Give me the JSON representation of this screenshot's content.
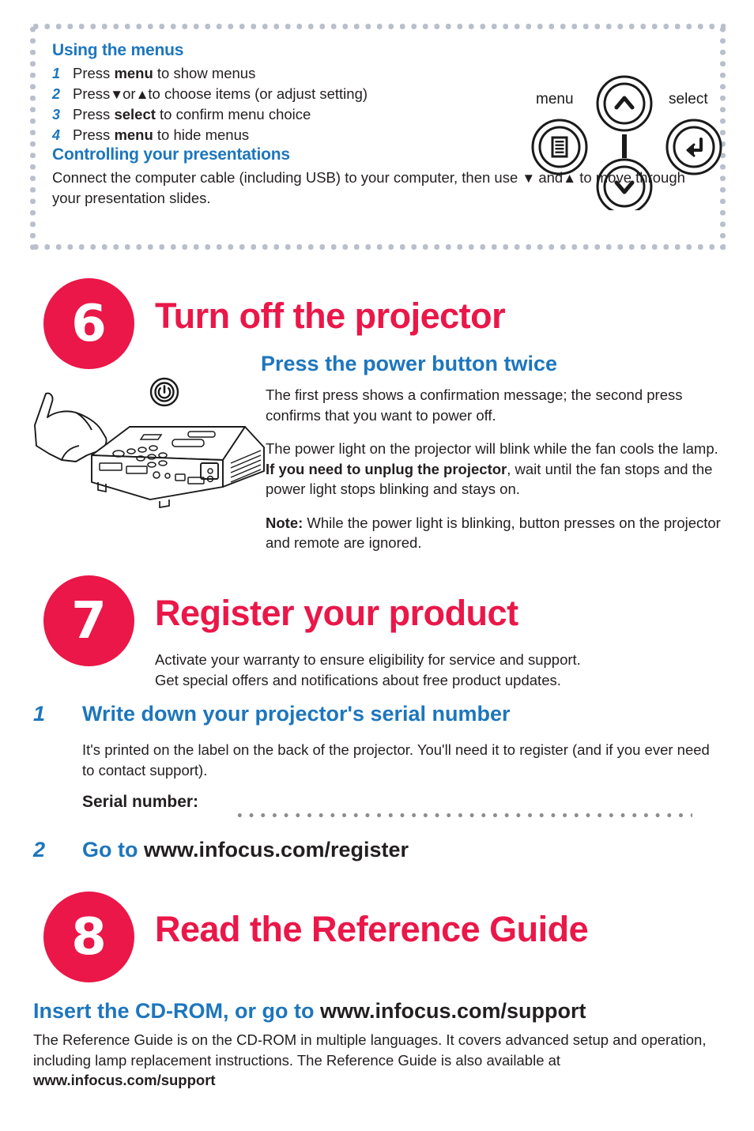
{
  "panel": {
    "menus_heading": "Using the menus",
    "steps": [
      {
        "num": "1",
        "pre": "Press ",
        "bold": "menu",
        "post": " to show menus"
      },
      {
        "num": "2",
        "pre": "Press",
        "chev_down": "⌄",
        "mid": "or",
        "chev_up": "⌃",
        "post": "to choose items (or adjust setting)"
      },
      {
        "num": "3",
        "pre": "Press ",
        "bold": "select",
        "post": " to confirm menu choice"
      },
      {
        "num": "4",
        "pre": "Press ",
        "bold": "menu",
        "post": " to hide menus"
      }
    ],
    "controlling_heading": "Controlling your presentations",
    "controlling_body_1": "Connect the computer cable (including USB) to your computer, then use ",
    "controlling_body_2": " and",
    "controlling_body_3": " to move through your presentation slides.",
    "diagram": {
      "menu_label": "menu",
      "select_label": "select"
    }
  },
  "step6": {
    "number": "6",
    "title": "Turn off the projector",
    "subtitle": "Press the power button twice",
    "para1": "The first press shows a confirmation message; the second press confirms that you want to power off.",
    "para2_a": "The power light on the projector will blink while the fan cools the lamp. ",
    "para2_bold": "If you need to unplug the projector",
    "para2_b": ", wait until the fan stops and the power light stops blinking and stays on.",
    "note_label": "Note:",
    "note_text": " While the power light is blinking, button presses on the projector and remote are ignored."
  },
  "step7": {
    "number": "7",
    "title": "Register your product",
    "intro_line1": "Activate your warranty to ensure eligibility for service and support.",
    "intro_line2": "Get special offers and notifications about free product updates.",
    "sub1": {
      "num": "1",
      "heading": "Write down your projector's serial number",
      "body": "It's printed on the label on the back of the projector. You'll need it to register (and if you ever need to contact support).",
      "serial_label": "Serial number:"
    },
    "sub2": {
      "num": "2",
      "heading_blue": "Go to ",
      "heading_black": "www.infocus.com/register"
    }
  },
  "step8": {
    "number": "8",
    "title": "Read the Reference Guide",
    "heading_blue": "Insert the CD-ROM, or go to ",
    "heading_black": "www.infocus.com/support",
    "body_a": "The Reference Guide is on the CD-ROM in multiple languages. It covers advanced setup and operation, including lamp replacement instructions. The Reference Guide is also available at ",
    "body_url": "www.infocus.com/support"
  },
  "colors": {
    "red": "#ea1748",
    "blue": "#1d76bd",
    "text": "#231f20",
    "dot_gray": "#b9c0cc"
  }
}
